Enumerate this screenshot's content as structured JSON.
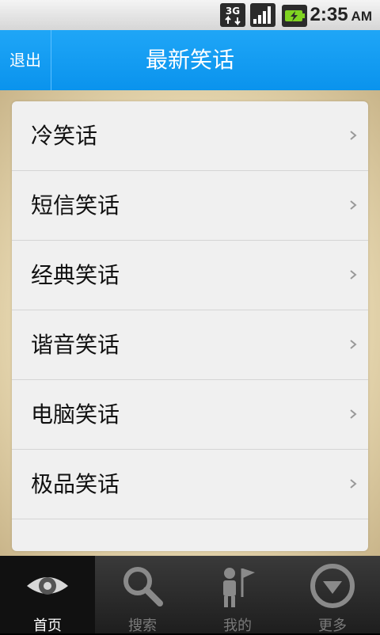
{
  "status_bar": {
    "network": "3G",
    "time": "2:35",
    "ampm": "AM"
  },
  "header": {
    "exit_label": "退出",
    "title": "最新笑话"
  },
  "categories": [
    {
      "label": "冷笑话"
    },
    {
      "label": "短信笑话"
    },
    {
      "label": "经典笑话"
    },
    {
      "label": "谐音笑话"
    },
    {
      "label": "电脑笑话"
    },
    {
      "label": "极品笑话"
    }
  ],
  "tabs": [
    {
      "label": "首页",
      "icon": "eye-icon",
      "active": true
    },
    {
      "label": "搜索",
      "icon": "magnifier-icon",
      "active": false
    },
    {
      "label": "我的",
      "icon": "person-flag-icon",
      "active": false
    },
    {
      "label": "更多",
      "icon": "down-arrow-circle-icon",
      "active": false
    }
  ],
  "colors": {
    "header_blue": "#0a93ed",
    "list_bg": "#f0f0f0",
    "tabbar_bg": "#2a2a2a"
  }
}
